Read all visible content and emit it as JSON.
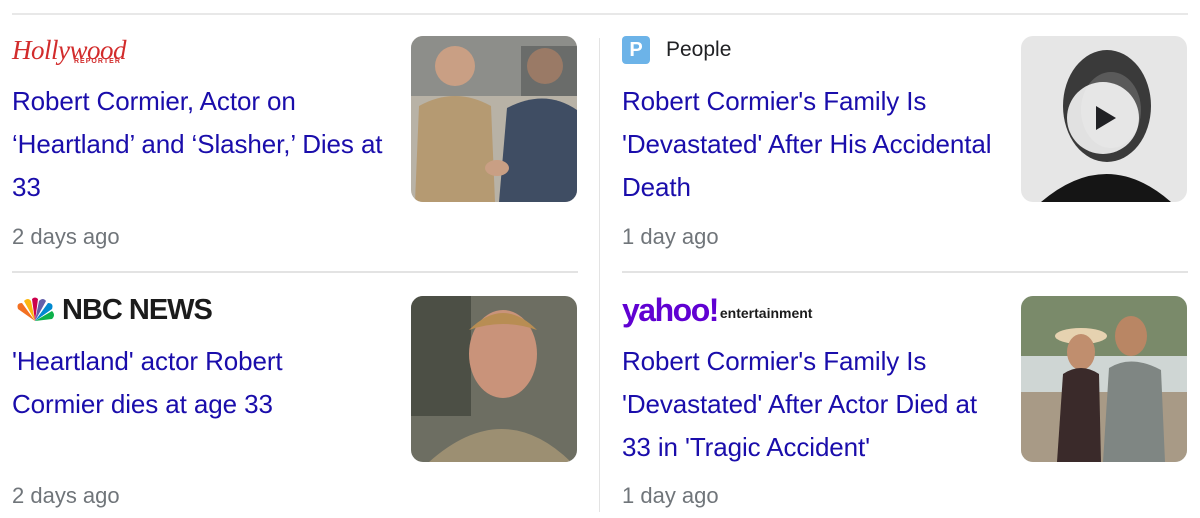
{
  "articles": [
    {
      "source": "The Hollywood Reporter",
      "logo_text": "Hollywood",
      "logo_small": "REPORTER",
      "headline": "Robert Cormier, Actor on ‘Heartland’ and ‘Slasher,’ Dies at 33",
      "time": "2 days ago",
      "brand_color": "#d22c2c"
    },
    {
      "source": "People",
      "logo_text": "P",
      "headline": "Robert Cormier's Family Is 'Devastated' After His Accidental Death",
      "time": "1 day ago",
      "brand_color": "#6cb3e8",
      "has_video": true
    },
    {
      "source": "NBC NEWS",
      "headline": "'Heartland' actor Robert Cormier dies at age 33",
      "time": "2 days ago"
    },
    {
      "source": "yahoo!",
      "logo_small": "entertainment",
      "headline": "Robert Cormier's Family Is 'Devastated' After Actor Died at 33 in 'Tragic Accident'",
      "time": "1 day ago",
      "brand_color": "#6001d2"
    }
  ],
  "colors": {
    "headline": "#1a0dab",
    "meta": "#70757a",
    "divider": "#e3e3e3"
  }
}
